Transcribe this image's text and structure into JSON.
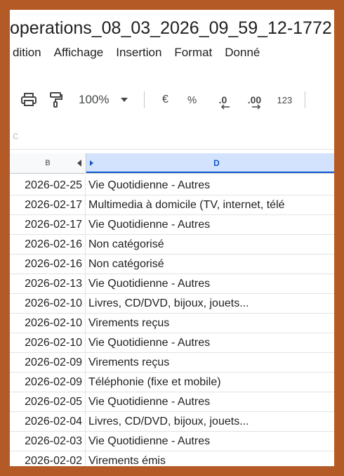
{
  "document": {
    "title": "operations_08_03_2026_09_59_12-1772"
  },
  "menu": {
    "items": [
      "dition",
      "Affichage",
      "Insertion",
      "Format",
      "Donné"
    ]
  },
  "toolbar": {
    "zoom": "100%",
    "currency": "€",
    "percent": "%",
    "decrease_decimal": ".0",
    "increase_decimal": ".00",
    "number_format": "123"
  },
  "formula_bar": {
    "glyph": "c"
  },
  "columns": {
    "b": "B",
    "d": "D"
  },
  "rows": [
    {
      "date": "2026-02-25",
      "category": "Vie Quotidienne - Autres"
    },
    {
      "date": "2026-02-17",
      "category": "Multimedia à domicile (TV, internet, télé"
    },
    {
      "date": "2026-02-17",
      "category": "Vie Quotidienne - Autres"
    },
    {
      "date": "2026-02-16",
      "category": "Non catégorisé"
    },
    {
      "date": "2026-02-16",
      "category": "Non catégorisé"
    },
    {
      "date": "2026-02-13",
      "category": "Vie Quotidienne - Autres"
    },
    {
      "date": "2026-02-10",
      "category": "Livres, CD/DVD, bijoux, jouets..."
    },
    {
      "date": "2026-02-10",
      "category": "Virements reçus"
    },
    {
      "date": "2026-02-10",
      "category": "Vie Quotidienne - Autres"
    },
    {
      "date": "2026-02-09",
      "category": "Virements reçus"
    },
    {
      "date": "2026-02-09",
      "category": "Téléphonie (fixe et mobile)"
    },
    {
      "date": "2026-02-05",
      "category": "Vie Quotidienne - Autres"
    },
    {
      "date": "2026-02-04",
      "category": "Livres, CD/DVD, bijoux, jouets..."
    },
    {
      "date": "2026-02-03",
      "category": "Vie Quotidienne - Autres"
    },
    {
      "date": "2026-02-02",
      "category": "Virements émis"
    }
  ],
  "colors": {
    "frame": "#b35a26",
    "selected_column_bg": "#d3e3fd",
    "selected_column_text": "#0b57d0"
  }
}
